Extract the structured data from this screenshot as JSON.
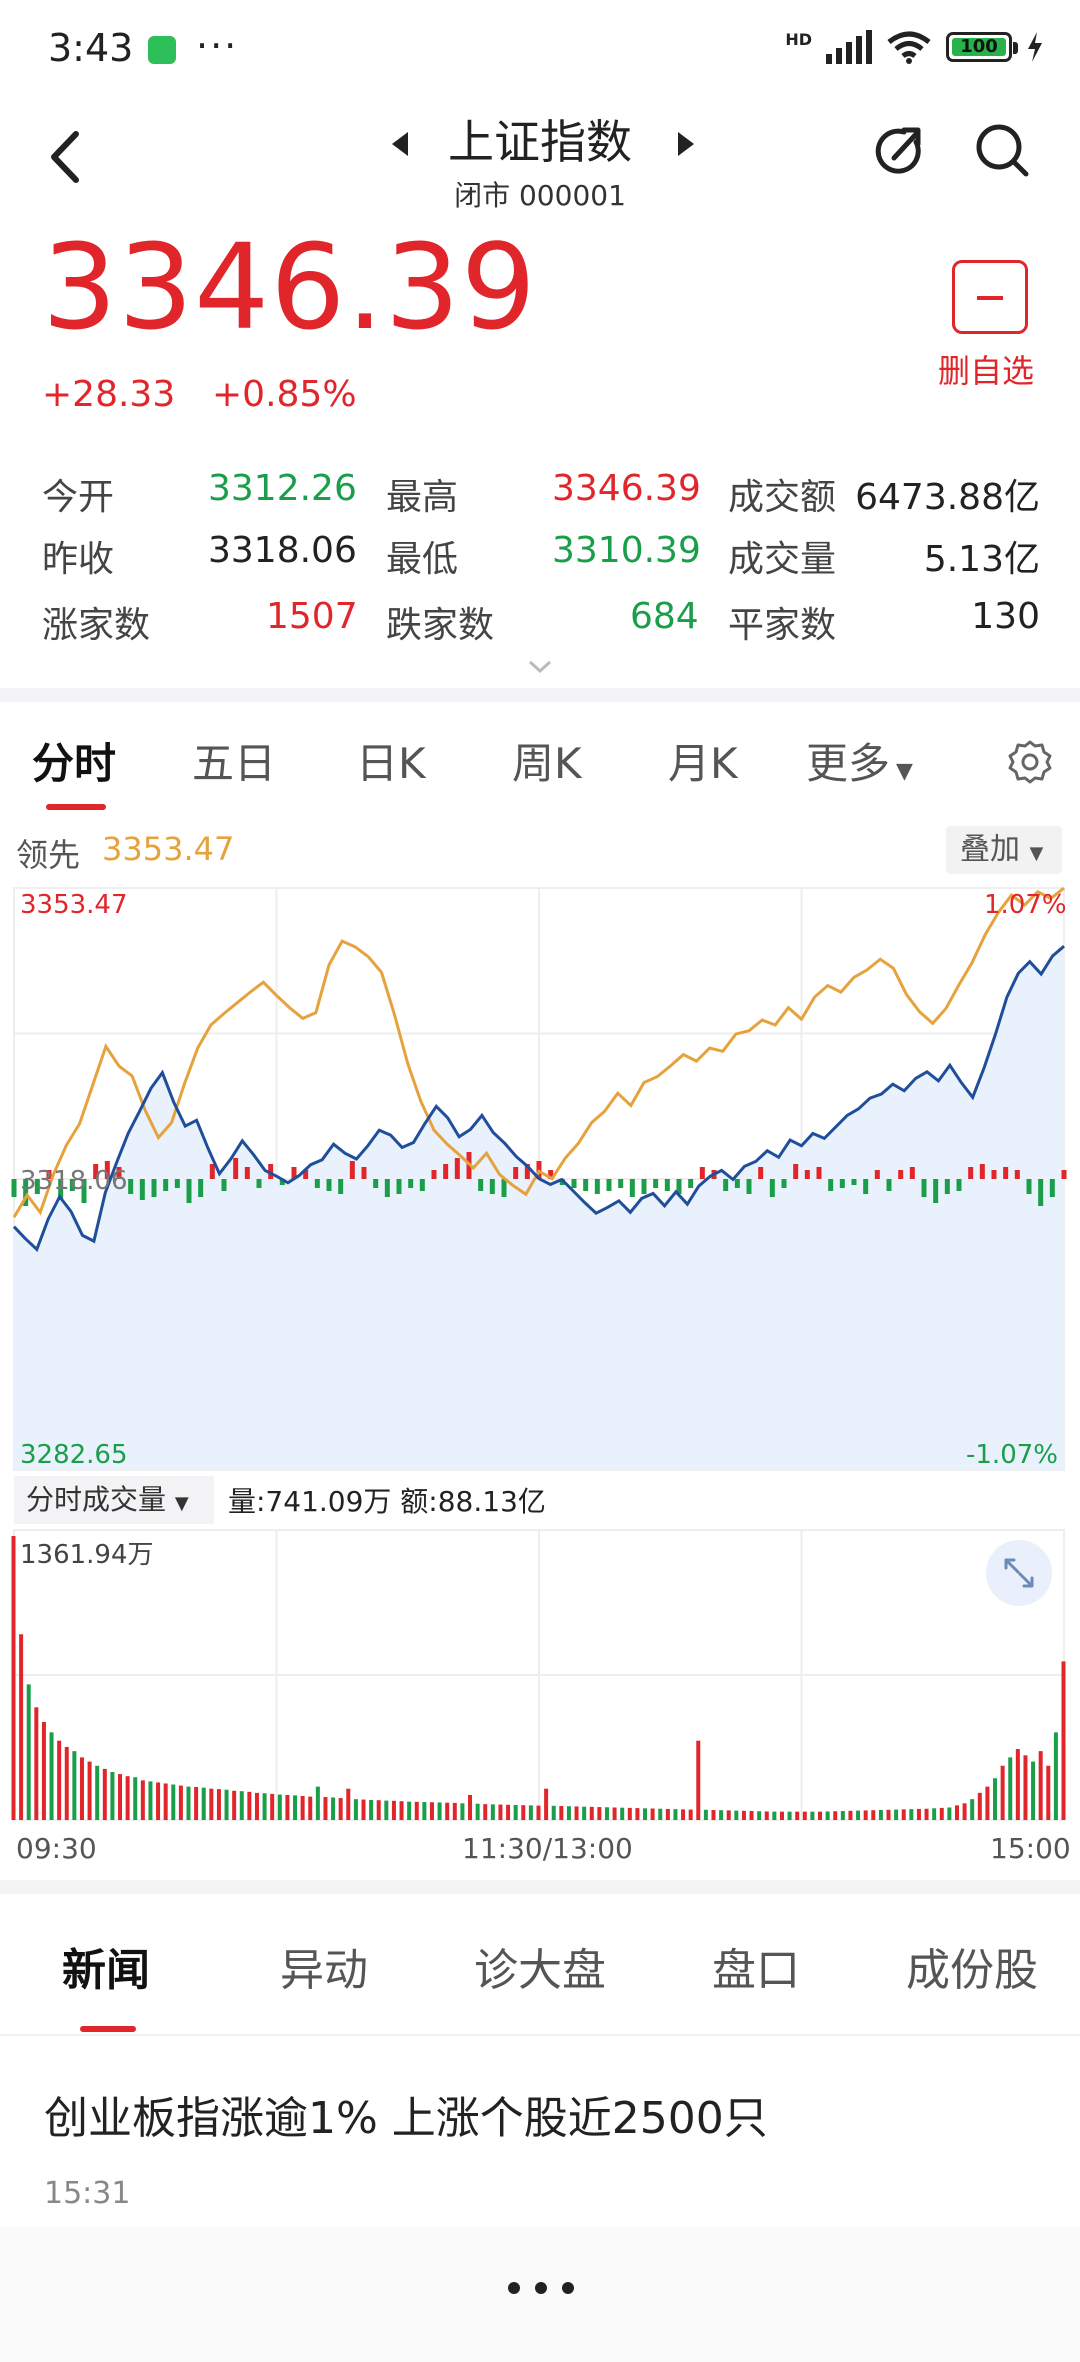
{
  "status_bar": {
    "time": "3:43",
    "battery": "100",
    "network": "HD"
  },
  "header": {
    "title": "上证指数",
    "subtitle": "闭市 000001"
  },
  "quote": {
    "price": "3346.39",
    "change": "+28.33",
    "change_pct": "+0.85%",
    "remove_label": "删自选"
  },
  "stats": {
    "open_label": "今开",
    "open": "3312.26",
    "high_label": "最高",
    "high": "3346.39",
    "turnover_label": "成交额",
    "turnover": "6473.88亿",
    "prev_label": "昨收",
    "prev": "3318.06",
    "low_label": "最低",
    "low": "3310.39",
    "volume_label": "成交量",
    "volume": "5.13亿",
    "up_label": "涨家数",
    "up": "1507",
    "down_label": "跌家数",
    "down": "684",
    "flat_label": "平家数",
    "flat": "130"
  },
  "chart_tabs": [
    "分时",
    "五日",
    "日K",
    "周K",
    "月K",
    "更多"
  ],
  "leader": {
    "label": "领先",
    "value": "3353.47",
    "overlay_label": "叠加"
  },
  "axis": {
    "top_left": "3353.47",
    "top_right": "1.07%",
    "mid_left": "3318.06",
    "bottom_left": "3282.65",
    "bottom_right": "-1.07%"
  },
  "volume_panel": {
    "tab_label": "分时成交量",
    "info": "量:741.09万  额:88.13亿",
    "max_label": "1361.94万"
  },
  "time_axis": {
    "start": "09:30",
    "mid": "11:30/13:00",
    "end": "15:00"
  },
  "news_tabs": [
    "新闻",
    "异动",
    "诊大盘",
    "盘口",
    "成份股"
  ],
  "news": {
    "headline": "创业板指涨逾1% 上涨个股近2500只",
    "time": "15:31"
  },
  "colors": {
    "up": "#e0262b",
    "down": "#1a9e4a",
    "price_line": "#1f4e9a",
    "lead_line": "#e6a23c",
    "fill": "#e8f1fc"
  },
  "chart_data": {
    "type": "line",
    "title": "",
    "y_range": [
      3282.65,
      3353.47
    ],
    "base": 3318.06,
    "series": [
      {
        "name": "",
        "points": [
          3312.26,
          3310.8,
          3309.5,
          3313.2,
          3315.9,
          3314.1,
          3311.2,
          3310.5,
          3316.4,
          3320.1,
          3323.6,
          3326.3,
          3329.1,
          3331.0,
          3327.4,
          3324.5,
          3325.2,
          3321.8,
          3318.7,
          3320.5,
          3322.7,
          3321.0,
          3319.1,
          3318.4,
          3317.6,
          3318.5,
          3319.8,
          3320.4,
          3322.3,
          3321.2,
          3320.5,
          3322.1,
          3324.0,
          3323.4,
          3321.9,
          3322.5,
          3324.8,
          3326.9,
          3325.5,
          3323.2,
          3324.1,
          3325.8,
          3323.7,
          3322.4,
          3320.8,
          3319.6,
          3318.1,
          3317.4,
          3318.0,
          3316.6,
          3315.2,
          3313.9,
          3314.6,
          3315.4,
          3314.0,
          3315.7,
          3316.3,
          3314.8,
          3316.5,
          3315.0,
          3317.2,
          3318.4,
          3319.1,
          3318.0,
          3319.6,
          3320.2,
          3321.5,
          3320.7,
          3322.8,
          3322.1,
          3323.6,
          3323.0,
          3324.4,
          3325.8,
          3326.6,
          3327.9,
          3328.4,
          3329.6,
          3328.8,
          3330.3,
          3331.1,
          3330.0,
          3331.9,
          3329.8,
          3328.0,
          3331.6,
          3335.7,
          3340.2,
          3343.1,
          3344.5,
          3343.0,
          3345.2,
          3346.39
        ]
      },
      {
        "name": "",
        "points": [
          3313.4,
          3316.1,
          3314.0,
          3318.6,
          3322.2,
          3324.8,
          3329.5,
          3334.2,
          3331.8,
          3330.6,
          3326.4,
          3323.1,
          3324.9,
          3329.7,
          3334.0,
          3336.8,
          3338.2,
          3339.5,
          3340.8,
          3342.0,
          3340.4,
          3338.9,
          3337.6,
          3338.3,
          3344.1,
          3347.0,
          3346.3,
          3345.1,
          3343.2,
          3338.0,
          3332.1,
          3327.5,
          3324.0,
          3322.3,
          3320.9,
          3319.4,
          3321.2,
          3318.6,
          3317.3,
          3316.2,
          3319.0,
          3318.1,
          3320.6,
          3322.4,
          3324.9,
          3326.3,
          3328.5,
          3327.0,
          3329.8,
          3330.5,
          3331.8,
          3333.2,
          3332.4,
          3334.0,
          3333.6,
          3335.7,
          3336.1,
          3337.4,
          3336.8,
          3338.9,
          3337.5,
          3340.2,
          3341.6,
          3340.8,
          3342.6,
          3343.5,
          3344.8,
          3343.7,
          3340.5,
          3338.4,
          3337.0,
          3338.8,
          3341.7,
          3344.4,
          3347.8,
          3350.5,
          3352.6,
          3351.4,
          3353.0,
          3352.2,
          3353.47
        ]
      }
    ],
    "imbalance_bars": [
      -6,
      -9,
      -5,
      3,
      -7,
      -4,
      -8,
      5,
      6,
      4,
      -5,
      -7,
      -6,
      -4,
      -3,
      -8,
      -6,
      5,
      -4,
      7,
      4,
      -3,
      5,
      -2,
      4,
      3,
      -3,
      -4,
      -5,
      6,
      4,
      -3,
      -6,
      -5,
      -3,
      -4,
      3,
      5,
      7,
      9,
      -4,
      -5,
      -6,
      4,
      5,
      6,
      3,
      -2,
      -3,
      -4,
      -5,
      -4,
      -3,
      -6,
      -5,
      -3,
      -4,
      -5,
      -3,
      4,
      3,
      -4,
      -3,
      -5,
      4,
      -6,
      -3,
      5,
      3,
      4,
      -4,
      -3,
      -2,
      -5,
      3,
      -4,
      3,
      4,
      -6,
      -8,
      -5,
      -4,
      4,
      5,
      3,
      4,
      3,
      -5,
      -9,
      -6,
      3
    ]
  },
  "volume_data": {
    "max": "1361.94万",
    "bars": [
      1361,
      890,
      650,
      540,
      470,
      420,
      380,
      350,
      330,
      300,
      280,
      260,
      245,
      230,
      220,
      210,
      205,
      190,
      185,
      180,
      175,
      170,
      165,
      160,
      158,
      155,
      150,
      148,
      145,
      140,
      138,
      135,
      130,
      128,
      125,
      122,
      120,
      118,
      115,
      112,
      160,
      110,
      108,
      105,
      150,
      100,
      98,
      96,
      95,
      93,
      92,
      90,
      88,
      87,
      86,
      85,
      84,
      83,
      82,
      80,
      120,
      78,
      76,
      75,
      74,
      73,
      72,
      71,
      70,
      69,
      150,
      68,
      67,
      66,
      65,
      64,
      63,
      62,
      61,
      60,
      59,
      58,
      57,
      56,
      55,
      54,
      53,
      52,
      51,
      50,
      380,
      49,
      48,
      47,
      46,
      45,
      44,
      43,
      42,
      41,
      40,
      40,
      40,
      40,
      40,
      40,
      40,
      41,
      42,
      43,
      44,
      45,
      46,
      47,
      48,
      49,
      50,
      51,
      52,
      53,
      54,
      56,
      58,
      60,
      70,
      80,
      100,
      130,
      160,
      200,
      260,
      300,
      340,
      310,
      280,
      330,
      260,
      420,
      760
    ],
    "colors_up_mask": [
      1,
      1,
      0,
      1,
      1,
      0,
      1,
      1,
      0,
      1,
      1,
      0,
      1,
      0,
      1,
      1,
      0,
      1,
      0,
      1,
      1,
      0,
      1,
      0,
      1,
      0,
      1,
      1,
      0,
      1,
      0,
      1,
      1,
      0,
      1,
      0,
      1,
      0,
      1,
      1,
      0,
      1,
      0,
      1,
      1,
      0,
      1,
      0,
      1,
      0,
      1,
      1,
      0,
      1,
      0,
      1,
      0,
      1,
      1,
      0,
      1,
      0,
      1,
      0,
      1,
      1,
      0,
      1,
      0,
      1,
      1,
      0,
      1,
      0,
      1,
      0,
      1,
      1,
      0,
      1,
      0,
      1,
      1,
      0,
      1,
      0,
      1,
      0,
      1,
      1,
      1,
      0,
      1,
      0,
      1,
      0,
      1,
      1,
      0,
      1,
      0,
      1,
      0,
      1,
      1,
      0,
      1,
      0,
      1,
      0,
      1,
      0,
      1,
      1,
      0,
      1,
      0,
      1,
      0,
      1,
      1,
      0,
      1,
      0,
      1,
      1,
      0,
      1,
      1,
      0,
      1,
      0,
      1,
      1,
      0,
      1,
      1,
      0,
      1
    ]
  }
}
